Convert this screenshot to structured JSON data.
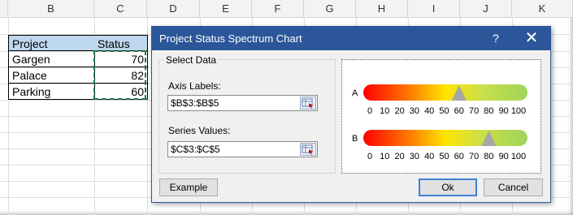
{
  "sheet": {
    "columns": [
      "B",
      "C",
      "D",
      "E",
      "F",
      "G",
      "H",
      "I",
      "J",
      "K"
    ],
    "table": {
      "headers": [
        "Project",
        "Status"
      ],
      "rows": [
        [
          "Gargen",
          "70"
        ],
        [
          "Palace",
          "82"
        ],
        [
          "Parking",
          "60"
        ]
      ]
    }
  },
  "dialog": {
    "title": "Project Status Spectrum Chart",
    "help_glyph": "?",
    "close_glyph": "✕",
    "group_title": "Select Data",
    "axis_label": "Axis Labels:",
    "axis_value": "$B$3:$B$5",
    "series_label": "Series Values:",
    "series_value": "$C$3:$C$5",
    "buttons": {
      "example": "Example",
      "ok": "Ok",
      "cancel": "Cancel"
    },
    "preview": {
      "bars": [
        {
          "label": "A",
          "value": 60
        },
        {
          "label": "B",
          "value": 80
        }
      ],
      "ticks": [
        "0",
        "10",
        "20",
        "30",
        "40",
        "50",
        "60",
        "70",
        "80",
        "90",
        "100"
      ],
      "gradient": [
        "#ff0000",
        "#ff7a00",
        "#ffe500",
        "#c9e048",
        "#9ed45a"
      ],
      "marker_color": "#a6a6a6"
    }
  }
}
